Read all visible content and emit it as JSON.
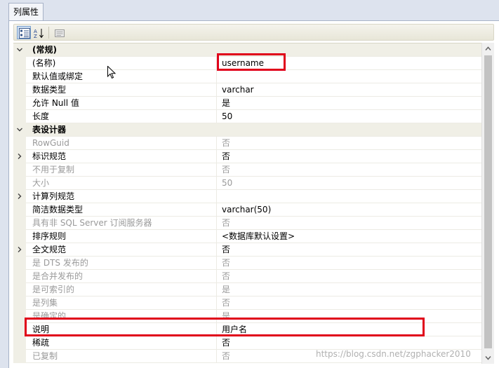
{
  "tab": {
    "label": "列属性"
  },
  "toolbar": {
    "buttons": [
      {
        "icon": "categorized-icon",
        "active": true
      },
      {
        "icon": "alphabetical-sort-icon",
        "active": false
      },
      {
        "icon": "property-pages-icon",
        "active": false
      }
    ]
  },
  "rows": [
    {
      "type": "category",
      "name": "(常规)",
      "expanded": true
    },
    {
      "type": "prop",
      "name": "(名称)",
      "value": "username"
    },
    {
      "type": "prop",
      "name": "默认值或绑定",
      "value": ""
    },
    {
      "type": "prop",
      "name": "数据类型",
      "value": "varchar"
    },
    {
      "type": "prop",
      "name": "允许 Null 值",
      "value": "是"
    },
    {
      "type": "prop",
      "name": "长度",
      "value": "50"
    },
    {
      "type": "category",
      "name": "表设计器",
      "expanded": true
    },
    {
      "type": "prop",
      "name": "RowGuid",
      "value": "否",
      "disabled": true
    },
    {
      "type": "prop",
      "name": "标识规范",
      "value": "否",
      "expandable": true
    },
    {
      "type": "prop",
      "name": "不用于复制",
      "value": "否",
      "disabled": true
    },
    {
      "type": "prop",
      "name": "大小",
      "value": "50",
      "disabled": true
    },
    {
      "type": "prop",
      "name": "计算列规范",
      "value": "",
      "expandable": true
    },
    {
      "type": "prop",
      "name": "简洁数据类型",
      "value": "varchar(50)"
    },
    {
      "type": "prop",
      "name": "具有非 SQL Server 订阅服务器",
      "value": "否",
      "disabled": true
    },
    {
      "type": "prop",
      "name": "排序规则",
      "value": "<数据库默认设置>"
    },
    {
      "type": "prop",
      "name": "全文规范",
      "value": "否",
      "expandable": true
    },
    {
      "type": "prop",
      "name": "是 DTS 发布的",
      "value": "否",
      "disabled": true
    },
    {
      "type": "prop",
      "name": "是合并发布的",
      "value": "否",
      "disabled": true
    },
    {
      "type": "prop",
      "name": "是可索引的",
      "value": "是",
      "disabled": true
    },
    {
      "type": "prop",
      "name": "是列集",
      "value": "否",
      "disabled": true
    },
    {
      "type": "prop",
      "name": "是确定的",
      "value": "是",
      "disabled": true
    },
    {
      "type": "prop",
      "name": "说明",
      "value": "用户名"
    },
    {
      "type": "prop",
      "name": "稀疏",
      "value": "否"
    },
    {
      "type": "prop",
      "name": "已复制",
      "value": "否",
      "disabled": true
    }
  ],
  "watermark": "https://blog.csdn.net/zgphacker2010",
  "colors": {
    "highlight": "#e0001a",
    "disabled_text": "#9a9a9a",
    "category_bg": "#f0efe6"
  }
}
